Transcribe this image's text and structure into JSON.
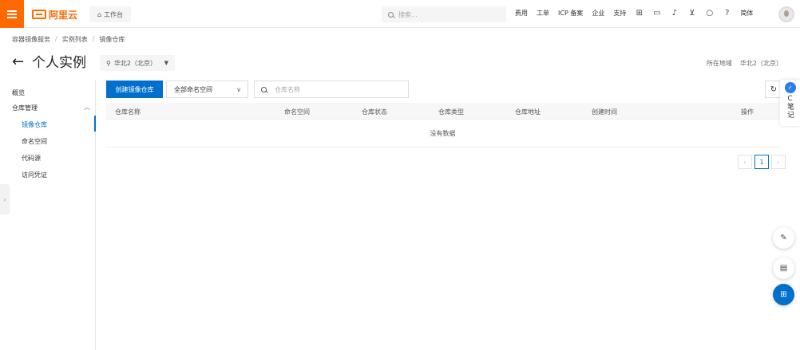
{
  "topbar": {
    "logo_text": "阿里云",
    "workbench_label": "工作台",
    "search_placeholder": "搜索...",
    "nav": [
      "费用",
      "工单",
      "ICP 备案",
      "企业",
      "支持"
    ],
    "lang_label": "简体"
  },
  "breadcrumb": [
    "容器镜像服务",
    "实例列表",
    "镜像仓库"
  ],
  "header": {
    "back_arrow": "←",
    "title": "个人实例",
    "region_select": "华北2（北京）",
    "region_label": "所在地域",
    "region_value": "华北2（北京）"
  },
  "sidebar": {
    "overview": "概览",
    "group": "仓库管理",
    "items": [
      "镜像仓库",
      "命名空间",
      "代码源",
      "访问凭证"
    ]
  },
  "toolbar": {
    "create_label": "创建镜像仓库",
    "namespace_select": "全部命名空间",
    "repo_search_placeholder": "仓库名称"
  },
  "table": {
    "columns": [
      "仓库名称",
      "命名空间",
      "仓库状态",
      "仓库类型",
      "仓库地址",
      "创建时间",
      "操作"
    ],
    "empty_text": "没有数据"
  },
  "pagination": {
    "current_page": "1"
  },
  "note_panel": {
    "letter": "C",
    "label": "笔记"
  },
  "colors": {
    "brand": "#ff6a00",
    "primary": "#0070cc"
  }
}
